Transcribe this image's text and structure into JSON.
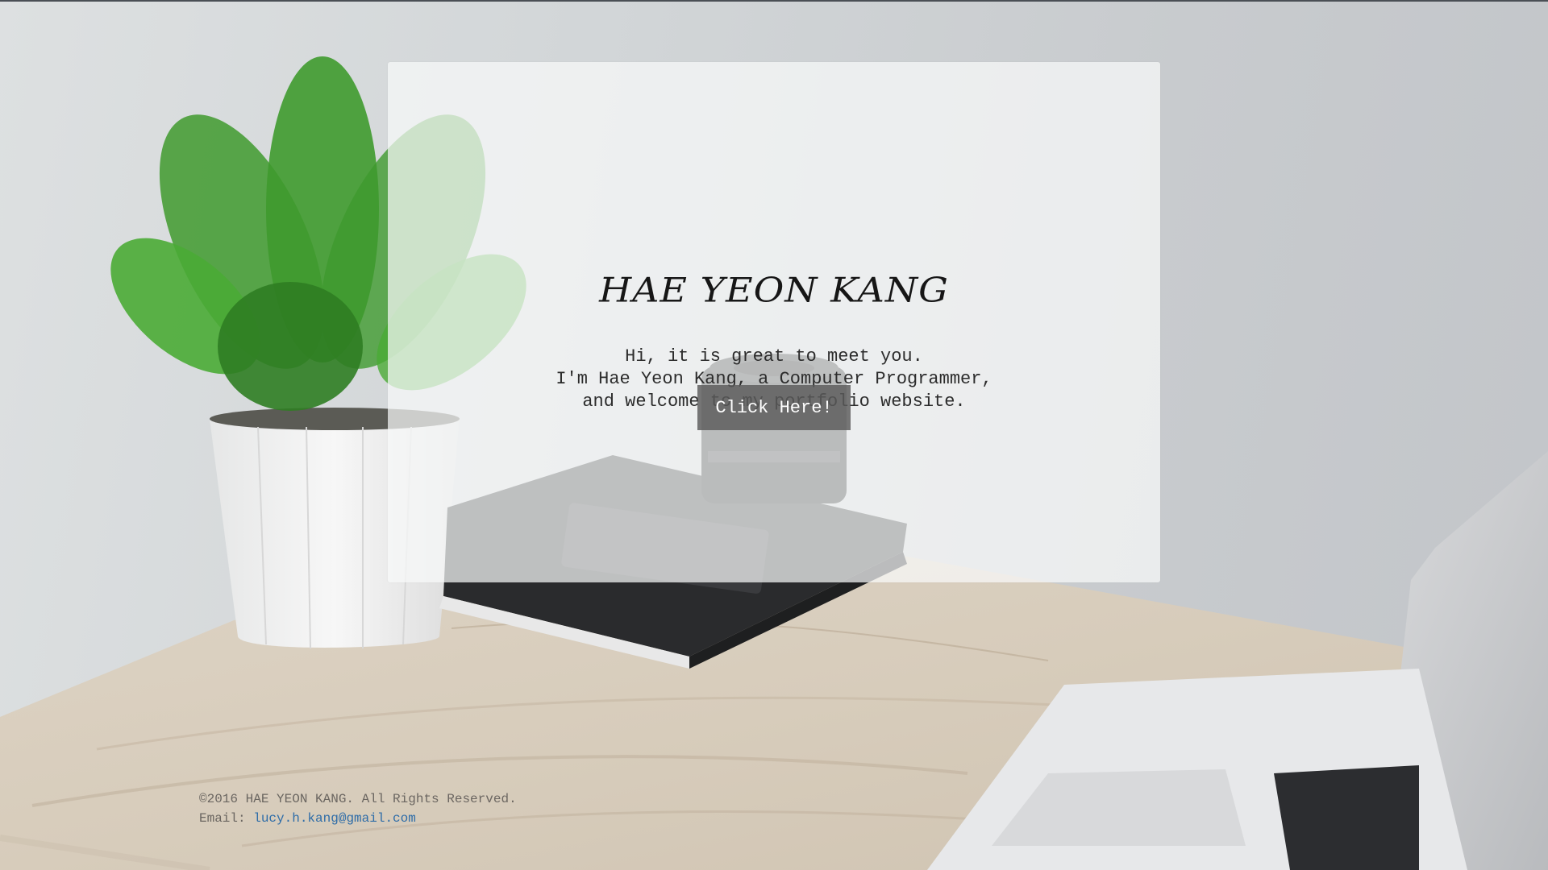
{
  "hero": {
    "name": "HAE YEON KANG",
    "intro_lines": [
      "Hi, it is great to meet you.",
      "I'm Hae Yeon Kang, a Computer Programmer,",
      "and welcome to my portfolio website."
    ],
    "button_label": "Click Here!"
  },
  "footer": {
    "copyright": "©2016 HAE YEON KANG. All Rights Reserved.",
    "email_label": "Email:",
    "email": "lucy.h.kang@gmail.com"
  },
  "colors": {
    "card_background": "#f8f9fa",
    "button_background": "#5a5a5a",
    "link": "#2f6da8",
    "footer_text": "#6b6661"
  }
}
